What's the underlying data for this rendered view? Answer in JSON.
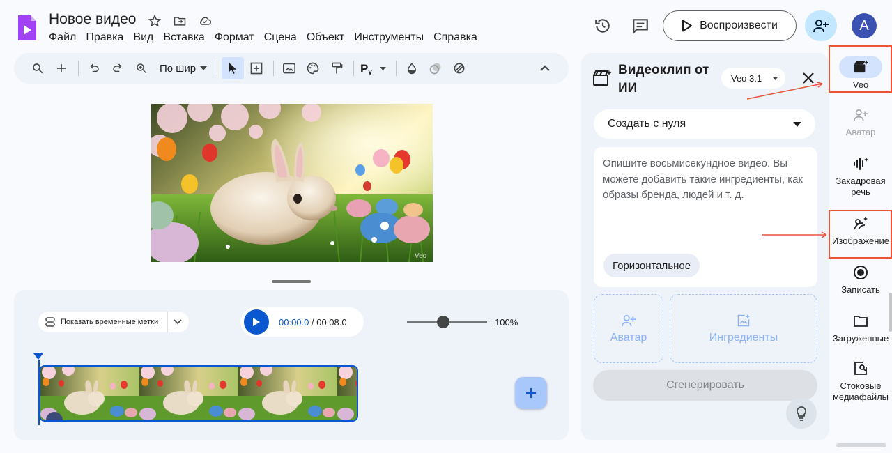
{
  "header": {
    "title": "Новое видео",
    "menu": [
      "Файл",
      "Правка",
      "Вид",
      "Вставка",
      "Формат",
      "Сцена",
      "Объект",
      "Инструменты",
      "Справка"
    ],
    "play_label": "Воспроизвести",
    "avatar_letter": "A"
  },
  "toolbar": {
    "zoom_label": "По шир"
  },
  "canvas": {
    "watermark": "Veo"
  },
  "timeline": {
    "timestamps_label": "Показать временные метки",
    "current_time": "00:00.0",
    "total_time": "/ 00:08.0",
    "zoom_percent": "100%",
    "zoom_level": 0.45
  },
  "panel": {
    "title": "Видеоклип от ИИ",
    "model": "Veo 3.1",
    "mode": "Создать с нуля",
    "prompt_placeholder": "Опишите восьмисекундное видео. Вы можете добавить такие ингредиенты, как образы бренда, людей и т. д.",
    "orientation": "Горизонтальное",
    "slot_avatar": "Аватар",
    "slot_ingredients": "Ингредиенты",
    "generate_label": "Сгенерировать"
  },
  "rail": {
    "veo": "Veo",
    "avatar": "Аватар",
    "voiceover_1": "Закадровая",
    "voiceover_2": "речь",
    "image": "Изображение",
    "record": "Записать",
    "uploads": "Загруженные",
    "stock_1": "Стоковые",
    "stock_2": "медиафайлы"
  },
  "colors": {
    "accent": "#0b57d0",
    "highlight": "#e8533a",
    "panel_bg": "#eef2f9"
  }
}
